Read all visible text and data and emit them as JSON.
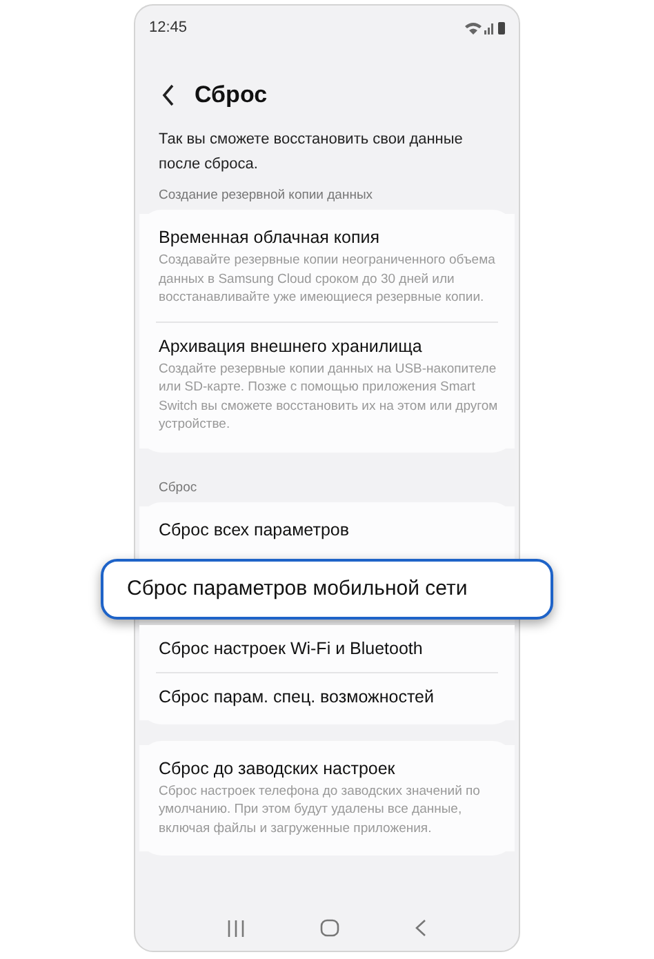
{
  "status_bar": {
    "time": "12:45"
  },
  "header": {
    "title": "Сброс"
  },
  "intro": "Так вы сможете восстановить свои данные после сброса.",
  "sections": [
    {
      "label": "Создание резервной копии данных",
      "cards": [
        [
          {
            "title": "Временная облачная копия",
            "description": "Создавайте резервные копии неограниченного объема данных в Samsung Cloud сроком до 30 дней или восстанавливайте уже имеющиеся резервные копии.",
            "highlighted": false
          },
          {
            "title": "Архивация внешнего хранилища",
            "description": "Создайте резервные копии данных на USB-накопителе или SD-карте. Позже с помощью приложения Smart Switch вы сможете восстановить их на этом или другом устройстве.",
            "highlighted": false
          }
        ]
      ]
    },
    {
      "label": "Сброс",
      "cards": [
        [
          {
            "title": "Сброс всех параметров",
            "highlighted": false
          },
          {
            "title": "Сброс параметров мобильной сети",
            "highlighted": true
          },
          {
            "title": "Сброс настроек Wi-Fi и Bluetooth",
            "highlighted": false
          },
          {
            "title": "Сброс парам. спец. возможностей",
            "highlighted": false
          }
        ],
        [
          {
            "title": "Сброс до заводских настроек",
            "description": "Сброс настроек телефона до заводских значений по умолчанию. При этом будут удалены все данные, включая файлы и загруженные приложения.",
            "highlighted": false
          }
        ]
      ]
    }
  ]
}
